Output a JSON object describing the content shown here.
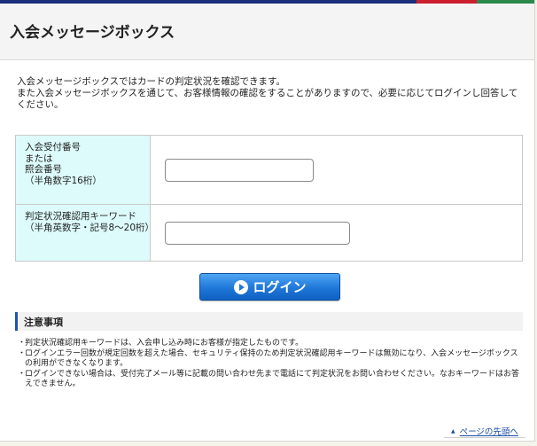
{
  "brand_colors": {
    "navy": "#1c2f7c",
    "red": "#cc1e2d",
    "green": "#2a8a4a"
  },
  "header": {
    "title": "入会メッセージボックス"
  },
  "intro": {
    "line1": "入会メッセージボックスではカードの判定状況を確認できます。",
    "line2": "また入会メッセージボックスを通じて、お客様情報の確認をすることがありますので、必要に応じてログインし回答してください。"
  },
  "form": {
    "row1": {
      "label_lines": [
        "入会受付番号",
        "または",
        "照会番号",
        "（半角数字16桁）"
      ],
      "value": "",
      "placeholder": ""
    },
    "row2": {
      "label_lines": [
        "判定状況確認用キーワード",
        "（半角英数字・記号8～20桁）"
      ],
      "value": "",
      "placeholder": ""
    }
  },
  "login_button": {
    "label": "ログイン",
    "icon": "play-circle-icon"
  },
  "notice": {
    "heading": "注意事項",
    "bullet": "・",
    "items": [
      "判定状況確認用キーワードは、入会申し込み時にお客様が指定したものです。",
      "ログインエラー回数が規定回数を超えた場合、セキュリティ保持のため判定状況確認用キーワードは無効になり、入会メッセージボックスの利用ができなくなります。",
      "ログインできない場合は、受付完了メール等に記載の問い合わせ先まで電話にて判定状況をお問い合わせください。なおキーワードはお答えできません。"
    ]
  },
  "page_top": {
    "label": "ページの先頭へ",
    "icon": "triangle-up-icon"
  }
}
